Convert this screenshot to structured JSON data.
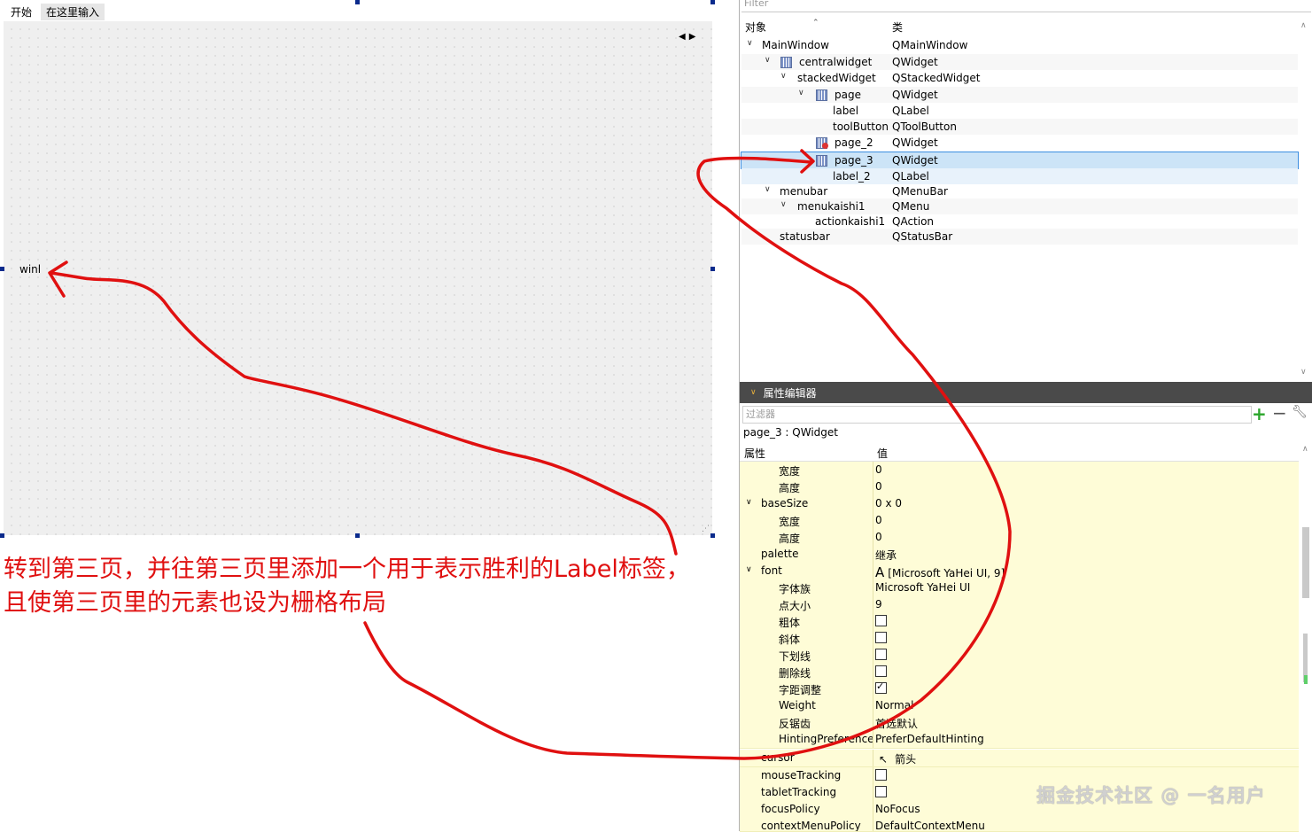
{
  "form": {
    "menu_start": "开始",
    "menu_type_here": "在这里输入",
    "label_text": "winl"
  },
  "annotation": {
    "line1": "转到第三页，并往第三页里添加一个用于表示胜利的Label标签，",
    "line2": "且使第三页里的元素也设为栅格布局",
    "color": "#e01010"
  },
  "object_inspector": {
    "filter_placeholder": "Filter",
    "col_object": "对象",
    "col_class": "类",
    "rows": [
      {
        "name": "MainWindow",
        "cls": "QMainWindow"
      },
      {
        "name": "centralwidget",
        "cls": "QWidget"
      },
      {
        "name": "stackedWidget",
        "cls": "QStackedWidget"
      },
      {
        "name": "page",
        "cls": "QWidget"
      },
      {
        "name": "label",
        "cls": "QLabel"
      },
      {
        "name": "toolButton",
        "cls": "QToolButton"
      },
      {
        "name": "page_2",
        "cls": "QWidget"
      },
      {
        "name": "page_3",
        "cls": "QWidget"
      },
      {
        "name": "label_2",
        "cls": "QLabel"
      },
      {
        "name": "menubar",
        "cls": "QMenuBar"
      },
      {
        "name": "menukaishi1",
        "cls": "QMenu"
      },
      {
        "name": "actionkaishi1",
        "cls": "QAction"
      },
      {
        "name": "statusbar",
        "cls": "QStatusBar"
      }
    ]
  },
  "property_editor": {
    "title": "属性编辑器",
    "filter_placeholder": "过滤器",
    "object_label": "page_3 : QWidget",
    "col_property": "属性",
    "col_value": "值",
    "rows": [
      {
        "name": "宽度",
        "value": "0"
      },
      {
        "name": "高度",
        "value": "0"
      },
      {
        "name": "baseSize",
        "value": "0 x 0"
      },
      {
        "name": "宽度",
        "value": "0"
      },
      {
        "name": "高度",
        "value": "0"
      },
      {
        "name": "palette",
        "value": "继承"
      },
      {
        "name": "font",
        "value": "[Microsoft YaHei UI, 9]"
      },
      {
        "name": "字体族",
        "value": "Microsoft YaHei UI"
      },
      {
        "name": "点大小",
        "value": "9"
      },
      {
        "name": "粗体",
        "value": "",
        "checked": false
      },
      {
        "name": "斜体",
        "value": "",
        "checked": false
      },
      {
        "name": "下划线",
        "value": "",
        "checked": false
      },
      {
        "name": "删除线",
        "value": "",
        "checked": false
      },
      {
        "name": "字距调整",
        "value": "",
        "checked": true
      },
      {
        "name": "Weight",
        "value": "Normal"
      },
      {
        "name": "反锯齿",
        "value": "首选默认"
      },
      {
        "name": "HintingPreference",
        "value": "PreferDefaultHinting"
      },
      {
        "name": "cursor",
        "value": "箭头"
      },
      {
        "name": "mouseTracking",
        "value": "",
        "checked": false
      },
      {
        "name": "tabletTracking",
        "value": "",
        "checked": false
      },
      {
        "name": "focusPolicy",
        "value": "NoFocus"
      },
      {
        "name": "contextMenuPolicy",
        "value": "DefaultContextMenu"
      }
    ]
  },
  "watermark": "掘金技术社区 @ 一名用户"
}
